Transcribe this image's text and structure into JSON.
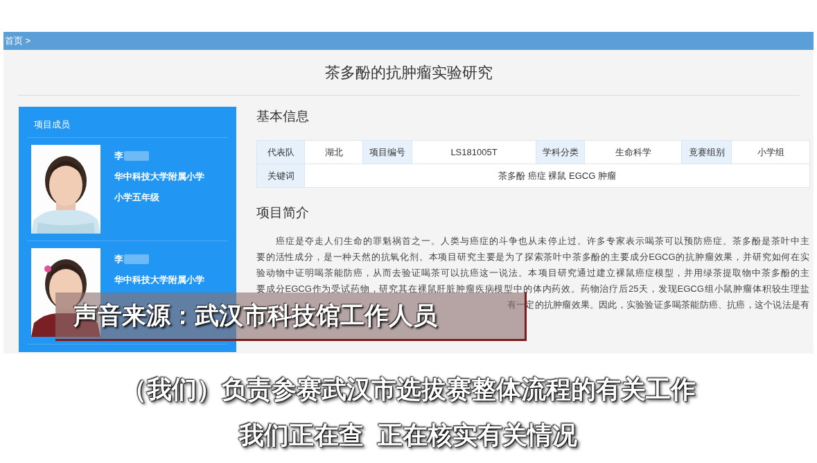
{
  "breadcrumb": "首页 >",
  "title": "茶多酚的抗肿瘤实验研究",
  "members": {
    "heading": "项目成员",
    "items": [
      {
        "surname": "李",
        "school": "华中科技大学附属小学",
        "grade": "小学五年级"
      },
      {
        "surname": "李",
        "school": "华中科技大学附属小学"
      }
    ]
  },
  "basic_info": {
    "heading": "基本信息",
    "rows": [
      [
        {
          "kind": "label",
          "text": "代表队"
        },
        {
          "kind": "value",
          "text": "湖北"
        },
        {
          "kind": "label",
          "text": "项目编号"
        },
        {
          "kind": "value",
          "text": "LS181005T"
        },
        {
          "kind": "label",
          "text": "学科分类"
        },
        {
          "kind": "value",
          "text": "生命科学"
        },
        {
          "kind": "label",
          "text": "竟赛组别"
        },
        {
          "kind": "value",
          "text": "小学组"
        }
      ],
      [
        {
          "kind": "label",
          "text": "关键词"
        },
        {
          "kind": "wide",
          "colspan": 7,
          "text": "茶多酚 癌症 裸鼠 EGCG 肿瘤"
        }
      ]
    ]
  },
  "intro": {
    "heading": "项目简介",
    "lines": [
      "癌症是夺走人们生命的罪魁祸首之一。人类与癌症的斗争也从未停止过。许多专家表示喝茶可以预防癌症。茶多酚是茶叶中主",
      "要的活性成分，是一种天然的抗氧化剂。本项目研究主要是为了探索茶叶中茶多酚的主要成分EGCG的抗肿瘤效果，并研究如何在实",
      "验动物中证明喝茶能防癌，从而去验证喝茶可以抗癌这一说法。本项目研究通过建立裸鼠癌症模型，并用绿茶提取物中茶多酚的主",
      "要成分EGCG作为受试药物，研究其在裸鼠肝脏肿瘤疾病模型中的体内药效。药物治疗后25天，发现EGCG组小鼠肿瘤体积较生理盐",
      "有一定的抗肿瘤效果。因此，实验验证多喝茶能防癌、抗癌，这个说法是有"
    ]
  },
  "caption": "声音来源：武汉市科技馆工作人员",
  "subtitles": [
    "（我们）负责参赛武汉市选拔赛整体流程的有关工作",
    "我们正在查  正在核实有关情况"
  ]
}
